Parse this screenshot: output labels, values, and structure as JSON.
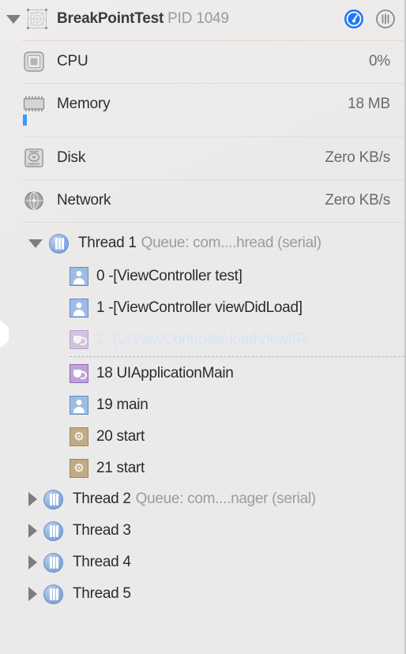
{
  "header": {
    "app_name": "BreakPointTest",
    "pid_label": "PID 1049",
    "disclosure_icon": "triangle-down-icon",
    "app_icon": "app-blueprint-icon",
    "buttons": [
      {
        "name": "gauge-view-button",
        "icon": "gauge-icon",
        "selected": true,
        "accent": "#1f7af3"
      },
      {
        "name": "thread-view-button",
        "icon": "thread-bars-icon",
        "selected": false,
        "accent": "#8a8a8a"
      }
    ]
  },
  "gauges": [
    {
      "label": "CPU",
      "value": "0%",
      "icon": "cpu-chip-icon"
    },
    {
      "label": "Memory",
      "value": "18 MB",
      "icon": "memory-chip-icon",
      "bar_color": "#3b99fc"
    },
    {
      "label": "Disk",
      "value": "Zero KB/s",
      "icon": "hard-disk-icon"
    },
    {
      "label": "Network",
      "value": "Zero KB/s",
      "icon": "network-globe-icon"
    }
  ],
  "threads": [
    {
      "name": "Thread 1",
      "queue": "Queue: com....hread (serial)",
      "expanded": true,
      "disclosure_icon": "triangle-down-icon",
      "icon": "thread-bars-icon",
      "frames": [
        {
          "label": "0 -[ViewController test]",
          "icon": "person-icon",
          "dimmed": false
        },
        {
          "label": "1 -[ViewController viewDidLoad]",
          "icon": "person-icon",
          "dimmed": false
        },
        {
          "label": "2 -[UIViewController loadViewIfR...",
          "icon": "cup-icon",
          "dimmed": true,
          "separator_after": true
        },
        {
          "label": "18 UIApplicationMain",
          "icon": "cup-icon",
          "dimmed": false
        },
        {
          "label": "19 main",
          "icon": "person-icon",
          "dimmed": false
        },
        {
          "label": "20 start",
          "icon": "gear-icon",
          "dimmed": false
        },
        {
          "label": "21 start",
          "icon": "gear-icon",
          "dimmed": false
        }
      ]
    },
    {
      "name": "Thread 2",
      "queue": "Queue: com....nager (serial)",
      "expanded": false,
      "disclosure_icon": "triangle-right-icon",
      "icon": "thread-bars-icon",
      "frames": []
    },
    {
      "name": "Thread 3",
      "queue": "",
      "expanded": false,
      "disclosure_icon": "triangle-right-icon",
      "icon": "thread-bars-icon",
      "frames": []
    },
    {
      "name": "Thread 4",
      "queue": "",
      "expanded": false,
      "disclosure_icon": "triangle-right-icon",
      "icon": "thread-bars-icon",
      "frames": []
    },
    {
      "name": "Thread 5",
      "queue": "",
      "expanded": false,
      "disclosure_icon": "triangle-right-icon",
      "icon": "thread-bars-icon",
      "frames": []
    }
  ]
}
